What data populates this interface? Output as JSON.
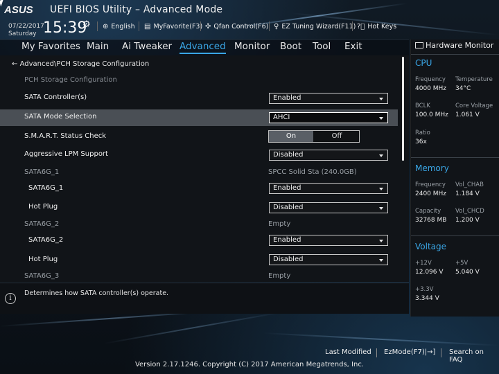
{
  "window": {
    "brand": "ASUS",
    "title": "UEFI BIOS Utility – Advanced Mode"
  },
  "status": {
    "date": "07/22/2017",
    "day": "Saturday",
    "time": "15:39"
  },
  "quickbar": [
    {
      "icon": "globe-icon",
      "label": "English"
    },
    {
      "icon": "favorite-icon",
      "label": "MyFavorite(F3)"
    },
    {
      "icon": "fan-icon",
      "label": "Qfan Control(F6)"
    },
    {
      "icon": "lightbulb-icon",
      "label": "EZ Tuning Wizard(F11)"
    },
    {
      "icon": "help-box-icon",
      "label": "Hot Keys"
    }
  ],
  "menu": [
    {
      "label": "My Favorites"
    },
    {
      "label": "Main"
    },
    {
      "label": "Ai Tweaker"
    },
    {
      "label": "Advanced",
      "active": true
    },
    {
      "label": "Monitor"
    },
    {
      "label": "Boot"
    },
    {
      "label": "Tool"
    },
    {
      "label": "Exit"
    }
  ],
  "breadcrumb": "Advanced\\PCH Storage Configuration",
  "section_title": "PCH Storage Configuration",
  "settings": {
    "sata_controller": {
      "label": "SATA Controller(s)",
      "value": "Enabled"
    },
    "sata_mode": {
      "label": "SATA Mode Selection",
      "value": "AHCI"
    },
    "smart": {
      "label": "S.M.A.R.T. Status Check",
      "on": "On",
      "off": "Off",
      "selected": "On"
    },
    "lpm": {
      "label": "Aggressive LPM Support",
      "value": "Disabled"
    },
    "port1": {
      "label": "SATA6G_1",
      "device": "SPCC Solid Sta (240.0GB)",
      "enable_label": "SATA6G_1",
      "enable_value": "Enabled",
      "hotplug_label": "Hot Plug",
      "hotplug_value": "Disabled"
    },
    "port2": {
      "label": "SATA6G_2",
      "device": "Empty",
      "enable_label": "SATA6G_2",
      "enable_value": "Enabled",
      "hotplug_label": "Hot Plug",
      "hotplug_value": "Disabled"
    },
    "port3": {
      "label": "SATA6G_3",
      "device": "Empty"
    }
  },
  "help_text": "Determines how SATA controller(s) operate.",
  "hardware_monitor": {
    "title": "Hardware Monitor",
    "cpu": {
      "heading": "CPU",
      "frequency_label": "Frequency",
      "frequency": "4000 MHz",
      "temperature_label": "Temperature",
      "temperature": "34°C",
      "bclk_label": "BCLK",
      "bclk": "100.0 MHz",
      "core_voltage_label": "Core Voltage",
      "core_voltage": "1.061 V",
      "ratio_label": "Ratio",
      "ratio": "36x"
    },
    "memory": {
      "heading": "Memory",
      "frequency_label": "Frequency",
      "frequency": "2400 MHz",
      "vol_chab_label": "Vol_CHAB",
      "vol_chab": "1.184 V",
      "capacity_label": "Capacity",
      "capacity": "32768 MB",
      "vol_chcd_label": "Vol_CHCD",
      "vol_chcd": "1.200 V"
    },
    "voltage": {
      "heading": "Voltage",
      "v12_label": "+12V",
      "v12": "12.096 V",
      "v5_label": "+5V",
      "v5": "5.040 V",
      "v33_label": "+3.3V",
      "v33": "3.344 V"
    }
  },
  "footer": {
    "last_modified": "Last Modified",
    "ezmode": "EzMode(F7)|→]",
    "search_faq": "Search on FAQ",
    "version": "Version 2.17.1246. Copyright (C) 2017 American Megatrends, Inc."
  }
}
